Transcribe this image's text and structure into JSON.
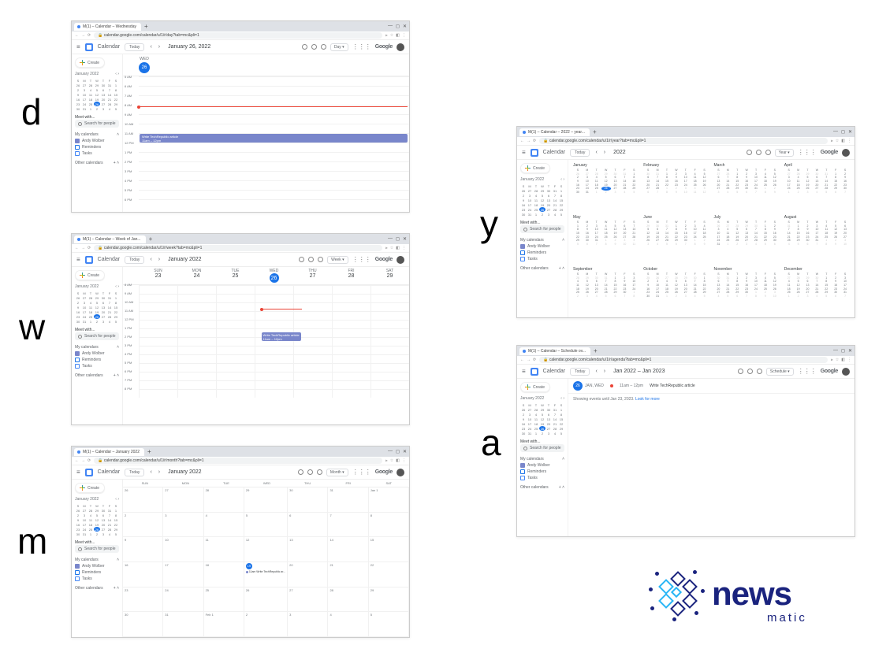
{
  "letters": {
    "d": "d",
    "w": "w",
    "m": "m",
    "y": "y",
    "a": "a"
  },
  "common": {
    "calendar": "Calendar",
    "today": "Today",
    "create": "Create",
    "google": "Google",
    "search_people": "Search for people",
    "meet_with": "Meet with...",
    "my_calendars": "My calendars",
    "other_calendars": "Other calendars",
    "andy": "Andy Wolber",
    "reminders": "Reminders",
    "tasks": "Tasks"
  },
  "minical": {
    "month": "January 2022",
    "dows": [
      "S",
      "M",
      "T",
      "W",
      "T",
      "F",
      "S"
    ],
    "rows": [
      [
        "26",
        "27",
        "28",
        "29",
        "30",
        "31",
        "1"
      ],
      [
        "2",
        "3",
        "4",
        "5",
        "6",
        "7",
        "8"
      ],
      [
        "9",
        "10",
        "11",
        "12",
        "13",
        "14",
        "15"
      ],
      [
        "16",
        "17",
        "18",
        "19",
        "20",
        "21",
        "22"
      ],
      [
        "23",
        "24",
        "25",
        "26",
        "27",
        "28",
        "29"
      ],
      [
        "30",
        "31",
        "1",
        "2",
        "3",
        "4",
        "5"
      ]
    ],
    "today_r": 4,
    "today_c": 3
  },
  "day": {
    "tab": "M(1) – Calendar – Wednesday",
    "url": "calendar.google.com/calendar/u/1/r/day?tab=mc&pli=1",
    "title": "January 26, 2022",
    "view": "Day",
    "dow": "WED",
    "num": "26",
    "hours": [
      "5 AM",
      "6 AM",
      "7 AM",
      "8 AM",
      "9 AM",
      "10 AM",
      "11 AM",
      "12 PM",
      "1 PM",
      "2 PM",
      "3 PM",
      "4 PM",
      "5 PM",
      "6 PM"
    ],
    "event_title": "Write TechRepublic article",
    "event_time": "11am – 12pm"
  },
  "week": {
    "tab": "M(1) – Calendar – Week of Jan...",
    "url": "calendar.google.com/calendar/u/1/r/week?tab=mc&pli=1",
    "title": "January 2022",
    "view": "Week",
    "cols": [
      {
        "dow": "SUN",
        "num": "23"
      },
      {
        "dow": "MON",
        "num": "24"
      },
      {
        "dow": "TUE",
        "num": "25"
      },
      {
        "dow": "WED",
        "num": "26",
        "today": true
      },
      {
        "dow": "THU",
        "num": "27"
      },
      {
        "dow": "FRI",
        "num": "28"
      },
      {
        "dow": "SAT",
        "num": "29"
      }
    ],
    "hours": [
      "8 AM",
      "9 AM",
      "10 AM",
      "11 AM",
      "12 PM",
      "1 PM",
      "2 PM",
      "3 PM",
      "4 PM",
      "5 PM",
      "6 PM",
      "7 PM",
      "8 PM"
    ],
    "event_title": "Write TechRepublic article",
    "event_time": "11am – 12pm"
  },
  "month": {
    "tab": "M(1) – Calendar – January 2022",
    "url": "calendar.google.com/calendar/u/1/r/month?tab=mc&pli=1",
    "title": "January 2022",
    "view": "Month",
    "dows": [
      "SUN",
      "MON",
      "TUE",
      "WED",
      "THU",
      "FRI",
      "SAT"
    ],
    "cells": [
      "26",
      "27",
      "28",
      "29",
      "30",
      "31",
      "Jan 1",
      "2",
      "3",
      "4",
      "5",
      "6",
      "7",
      "8",
      "9",
      "10",
      "11",
      "12",
      "13",
      "14",
      "15",
      "16",
      "17",
      "18",
      "19",
      "20",
      "21",
      "22",
      "23",
      "24",
      "25",
      "26",
      "27",
      "28",
      "29",
      "30",
      "31",
      "Feb 1",
      "2",
      "3",
      "4",
      "5"
    ],
    "today_idx": 24,
    "event_idx": 24,
    "event_text": "11am Write TechRepublic ar..."
  },
  "year": {
    "tab": "M(1) – Calendar – 2022 – year...",
    "url": "calendar.google.com/calendar/u/1/r/year?tab=mc&pli=1",
    "title": "2022",
    "view": "Year",
    "months": [
      "January",
      "February",
      "March",
      "April",
      "May",
      "June",
      "July",
      "August",
      "September",
      "October",
      "November",
      "December"
    ]
  },
  "sched": {
    "tab": "M(1) – Calendar – Schedule ov...",
    "url": "calendar.google.com/calendar/u/1/r/agenda?tab=mc&pli=1",
    "title": "Jan 2022 – Jan 2023",
    "view": "Schedule",
    "daynum": "26",
    "daydow": "JAN, WED",
    "time": "11am – 12pm",
    "event": "Write TechRepublic article",
    "more": "Showing events until Jan 23, 2023.",
    "look": "Look for more"
  },
  "logo": {
    "main": "news",
    "sub": "matic"
  }
}
